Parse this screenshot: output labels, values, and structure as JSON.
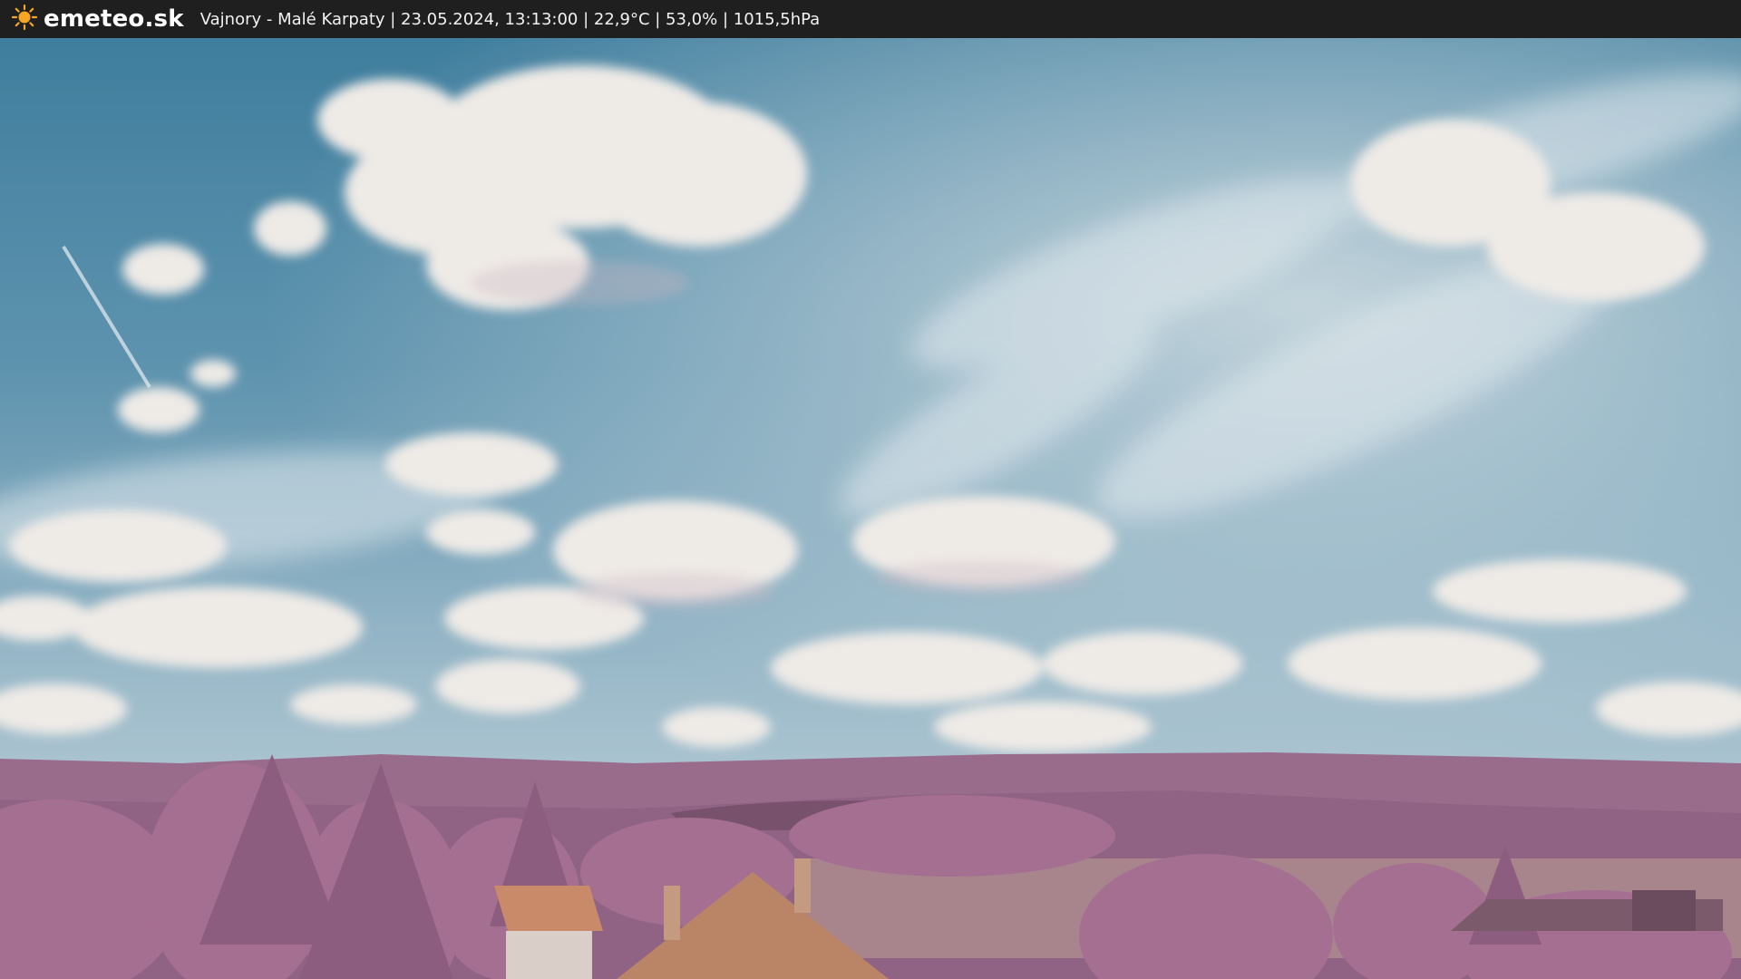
{
  "header": {
    "brand": "emeteo.sk",
    "caption": "Vajnory - Malé Karpaty | 23.05.2024, 13:13:00 | 22,9°C | 53,0% | 1015,5hPa",
    "logo_icon": "sun-icon",
    "logo_color": "#f5a623"
  },
  "scene": {
    "description_icon": "webcam-image",
    "colors": {
      "sky_top": "#3f7e9e",
      "sky_horizon": "#b8ccd4",
      "clouds": "#eeeae6",
      "hills": "#9a6c8c",
      "foliage": "#a56f92",
      "roof": "#c98a6a"
    }
  }
}
